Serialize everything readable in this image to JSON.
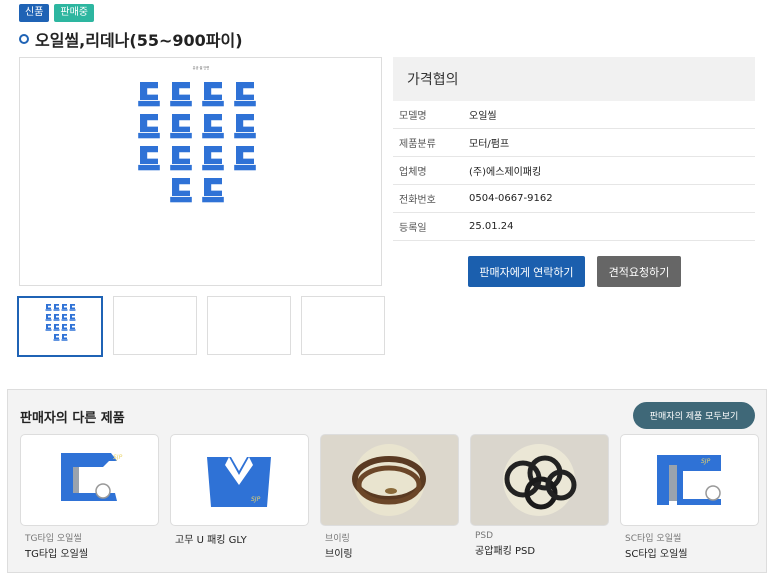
{
  "badges": {
    "new": "신품",
    "sale": "판매중"
  },
  "product": {
    "title": "오일씰,리데나(55~900파이)"
  },
  "main_image": {
    "caption": "유공 씰 단면"
  },
  "price": "가격협의",
  "info": [
    {
      "label": "모델명",
      "value": "오일씰"
    },
    {
      "label": "제품분류",
      "value": "모터/펌프"
    },
    {
      "label": "업체명",
      "value": "(주)에스제이패킹"
    },
    {
      "label": "전화번호",
      "value": "0504-0667-9162"
    },
    {
      "label": "등록일",
      "value": "25.01.24"
    }
  ],
  "buttons": {
    "contact": "판매자에게 연락하기",
    "quote": "견적요청하기"
  },
  "other": {
    "title": "판매자의 다른 제품",
    "view_all": "판매자의 제품 모두보기",
    "items": [
      {
        "category": "TG타입 오일씰",
        "name": "TG타입 오일씰"
      },
      {
        "category": "",
        "name": "고무 U 패킹 GLY"
      },
      {
        "category": "브이링",
        "name": "브이링"
      },
      {
        "category": "PSD",
        "name": "공압패킹 PSD"
      },
      {
        "category": "SC타입 오일씰",
        "name": "SC타입 오일씰"
      }
    ]
  },
  "colors": {
    "brand_blue": "#1f63b5",
    "seal_blue": "#2f72d6",
    "teal": "#2db6a0",
    "view_all_bg": "#3f6878"
  }
}
